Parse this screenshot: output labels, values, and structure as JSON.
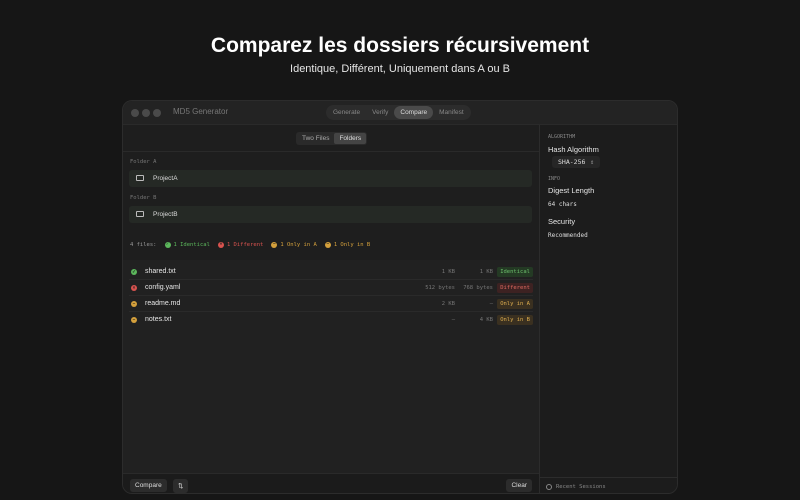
{
  "hero": {
    "title": "Comparez les dossiers récursivement",
    "subtitle": "Identique, Différent, Uniquement dans A ou B"
  },
  "window": {
    "title": "MD5 Generator",
    "tabs": [
      "Generate",
      "Verify",
      "Compare",
      "Manifest"
    ],
    "active_tab": "Compare"
  },
  "mode": {
    "options": [
      "Two Files",
      "Folders"
    ],
    "selected": "Folders"
  },
  "folder_a": {
    "label": "Folder A",
    "value": "ProjectA"
  },
  "folder_b": {
    "label": "Folder B",
    "value": "ProjectB"
  },
  "summary": {
    "count": "4 files:",
    "identical": "1 Identical",
    "different": "1 Different",
    "only_a": "1 Only in A",
    "only_b": "1 Only in B"
  },
  "files": [
    {
      "name": "shared.txt",
      "size_a": "1 KB",
      "size_b": "1 KB",
      "status": "Identical"
    },
    {
      "name": "config.yaml",
      "size_a": "512 bytes",
      "size_b": "768 bytes",
      "status": "Different"
    },
    {
      "name": "readme.md",
      "size_a": "2 KB",
      "size_b": "—",
      "status": "Only in A"
    },
    {
      "name": "notes.txt",
      "size_a": "—",
      "size_b": "4 KB",
      "status": "Only in B"
    }
  ],
  "footer": {
    "compare": "Compare",
    "swap_icon": "⇅",
    "clear": "Clear"
  },
  "sidebar": {
    "algorithm_caption": "ALGORITHM",
    "hash_label": "Hash Algorithm",
    "hash_value": "SHA-256",
    "info_caption": "INFO",
    "digest_label": "Digest Length",
    "digest_value": "64 chars",
    "security_label": "Security",
    "security_value": "Recommended",
    "recent": "Recent Sessions"
  },
  "colors": {
    "identical": "#5cb85c",
    "different": "#d9534f",
    "only": "#d4a03c"
  }
}
